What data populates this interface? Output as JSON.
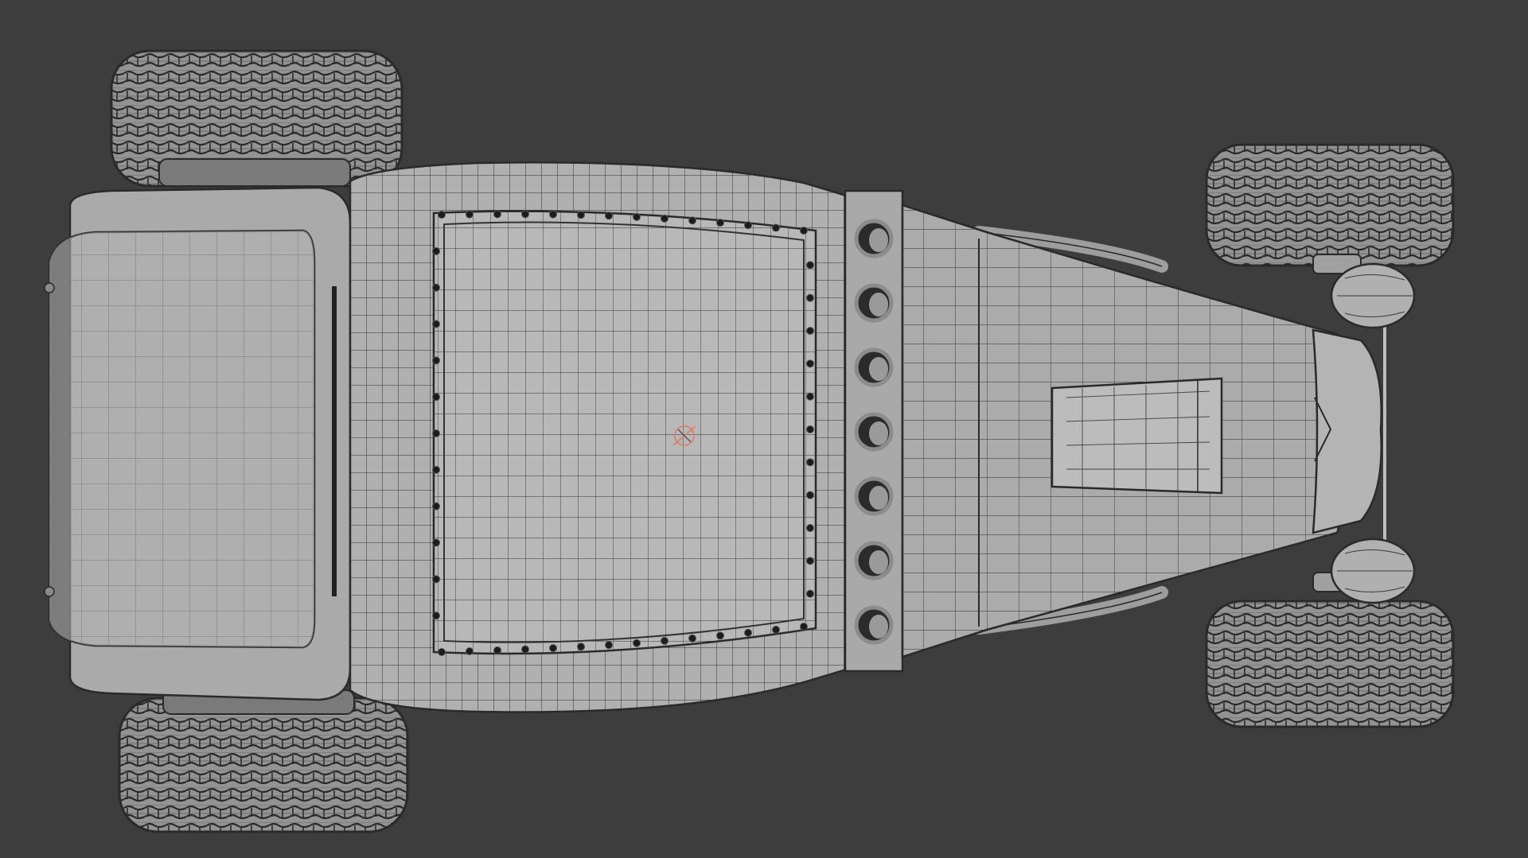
{
  "viewport": {
    "background_color": "#3d3d3d",
    "shading": "solid-wireframe",
    "view": "top"
  },
  "model": {
    "name": "",
    "parts": [
      "cab-roof",
      "body-deck",
      "deck-panel",
      "firewall-vents",
      "hood",
      "hood-scoop",
      "grille",
      "front-axle",
      "headlights",
      "rear-left-tire",
      "rear-right-tire",
      "front-left-tire",
      "front-right-tire"
    ],
    "colors": {
      "surface": "#a8a8a8",
      "surface_light": "#b3b3b3",
      "wire": "#2a2a2a",
      "tire": "#8f8f8f",
      "bolt": "#1c1c1c",
      "origin_marker": "#e07a6a"
    },
    "vent_count": 7
  }
}
